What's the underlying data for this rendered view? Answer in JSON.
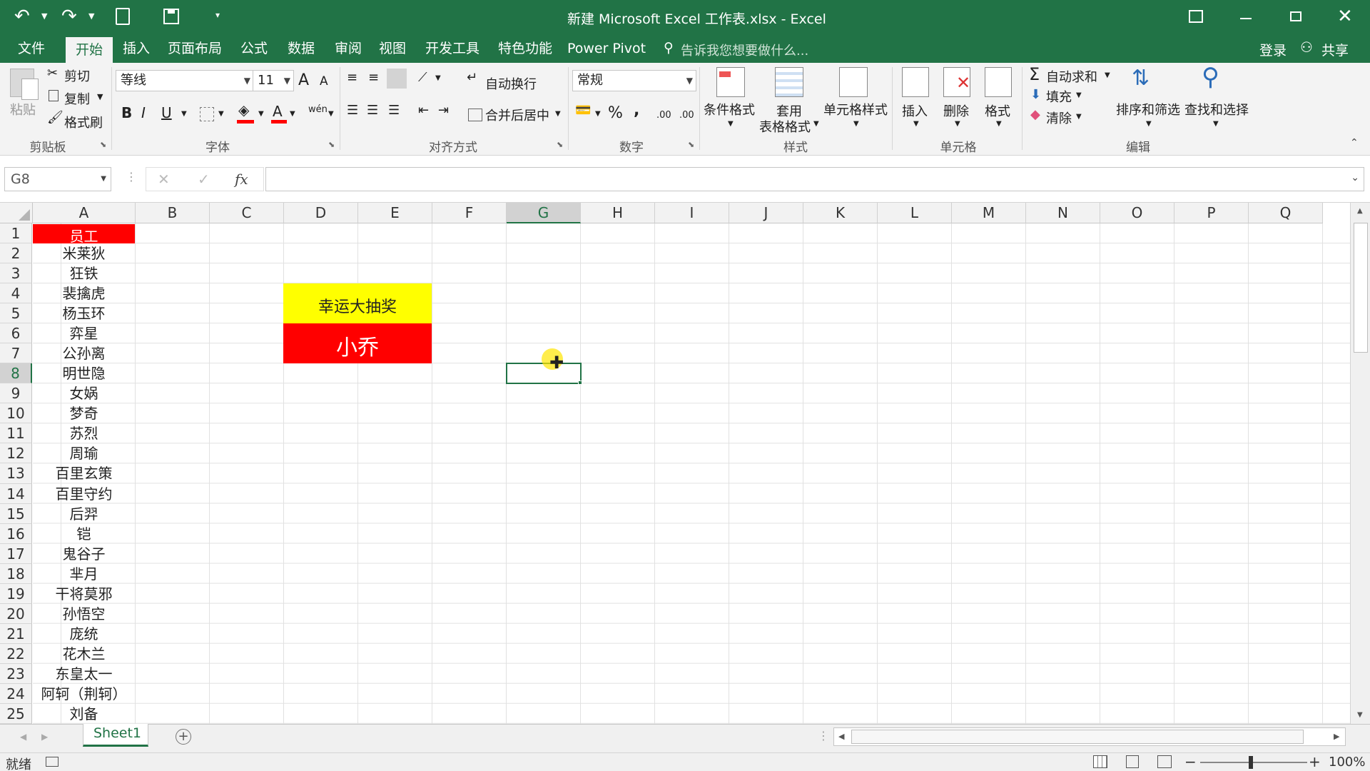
{
  "title_bar": {
    "title": "新建 Microsoft Excel 工作表.xlsx - Excel"
  },
  "menu": {
    "tabs": [
      "文件",
      "开始",
      "插入",
      "页面布局",
      "公式",
      "数据",
      "审阅",
      "视图",
      "开发工具",
      "特色功能",
      "Power Pivot"
    ],
    "tell_me": "告诉我您想要做什么...",
    "login": "登录",
    "share": "共享"
  },
  "ribbon": {
    "clipboard": {
      "paste": "粘贴",
      "cut": "剪切",
      "copy": "复制",
      "format_painter": "格式刷",
      "label": "剪贴板"
    },
    "font": {
      "name": "等线",
      "size": "11",
      "bold": "B",
      "italic": "I",
      "underline": "U",
      "grow": "A",
      "shrink": "A",
      "color_a": "A",
      "phonetic": "wén",
      "label": "字体"
    },
    "alignment": {
      "wrap": "自动换行",
      "merge": "合并后居中",
      "label": "对齐方式"
    },
    "number": {
      "format": "常规",
      "percent": "%",
      "comma": ",",
      "inc_decimal": ".00",
      "dec_decimal": ".00",
      "label": "数字"
    },
    "styles": {
      "conditional": "条件格式",
      "table_line1": "套用",
      "table_line2": "表格格式",
      "cell_styles": "单元格样式",
      "label": "样式"
    },
    "cells": {
      "insert": "插入",
      "delete": "删除",
      "format": "格式",
      "label": "单元格"
    },
    "editing": {
      "autosum": "自动求和",
      "fill": "填充",
      "clear": "清除",
      "sort_filter": "排序和筛选",
      "find_select": "查找和选择",
      "label": "编辑"
    }
  },
  "formula_bar": {
    "name_box": "G8",
    "fx": "fx",
    "value": ""
  },
  "grid": {
    "columns": [
      "A",
      "B",
      "C",
      "D",
      "E",
      "F",
      "G",
      "H",
      "I",
      "J",
      "K",
      "L",
      "M",
      "N",
      "O",
      "P",
      "Q"
    ],
    "rows": [
      "1",
      "2",
      "3",
      "4",
      "5",
      "6",
      "7",
      "8",
      "9",
      "10",
      "11",
      "12",
      "13",
      "14",
      "15",
      "16",
      "17",
      "18",
      "19",
      "20",
      "21",
      "22",
      "23",
      "24",
      "25"
    ],
    "column_a": [
      "员工",
      "米莱狄",
      "狂铁",
      "裴擒虎",
      "杨玉环",
      "弈星",
      "公孙离",
      "明世隐",
      "女娲",
      "梦奇",
      "苏烈",
      "周瑜",
      "百里玄策",
      "百里守约",
      "后羿",
      "铠",
      "鬼谷子",
      "芈月",
      "干将莫邪",
      "孙悟空",
      "庞统",
      "花木兰",
      "东皇太一",
      "阿轲（荆轲）",
      "刘备"
    ],
    "lottery_title": "幸运大抽奖",
    "lottery_winner": "小乔",
    "selected_cell": "G8"
  },
  "sheet_tabs": {
    "active": "Sheet1"
  },
  "status": {
    "ready": "就绪",
    "zoom": "100%"
  },
  "colors": {
    "accent": "#217346",
    "header_red": "#ff0000",
    "banner_yellow": "#ffff00"
  }
}
